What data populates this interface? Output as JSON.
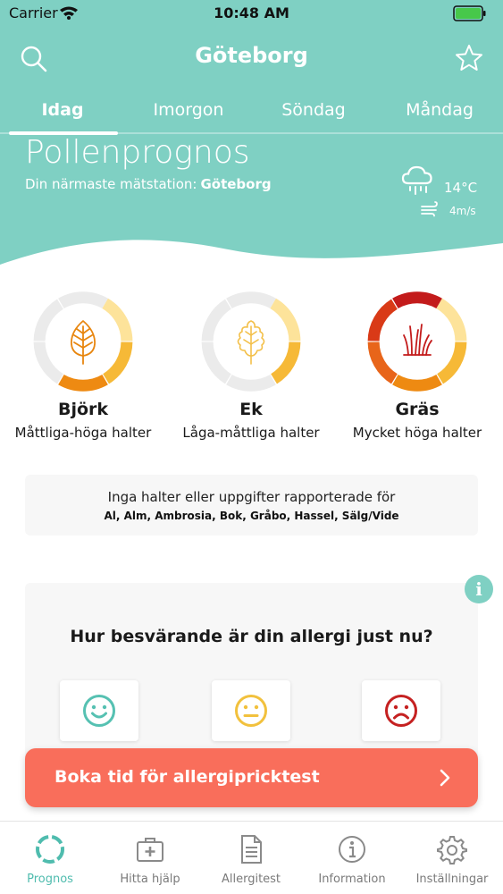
{
  "status_bar": {
    "carrier": "Carrier",
    "time": "10:48 AM"
  },
  "header": {
    "city": "Göteborg",
    "icons": [
      "search-icon",
      "star-icon"
    ]
  },
  "tabs": [
    {
      "label": "Idag",
      "active": true
    },
    {
      "label": "Imorgon",
      "active": false
    },
    {
      "label": "Söndag",
      "active": false
    },
    {
      "label": "Måndag",
      "active": false
    }
  ],
  "forecast": {
    "title": "Pollenprognos",
    "station_label": "Din närmaste mätstation:",
    "station_name": "Göteborg",
    "temperature": "14°C",
    "wind": "4m/s",
    "weather_icon": "cloud-rain-icon"
  },
  "pollen": [
    {
      "name": "Björk",
      "level": "Måttliga-höga halter",
      "icon": "birch-leaf-icon",
      "segments_filled": 3
    },
    {
      "name": "Ek",
      "level": "Låga-måttliga halter",
      "icon": "oak-leaf-icon",
      "segments_filled": 2
    },
    {
      "name": "Gräs",
      "level": "Mycket höga halter",
      "icon": "grass-icon",
      "segments_filled": 6
    }
  ],
  "no_data": {
    "text": "Inga halter eller uppgifter rapporterade för",
    "species": "Al, Alm, Ambrosia, Bok, Gråbo, Hassel, Sälg/Vide"
  },
  "allergy": {
    "question": "Hur besvärande är din allergi just nu?",
    "faces": [
      "happy-face-icon",
      "neutral-face-icon",
      "sad-face-icon"
    ]
  },
  "cta": {
    "label": "Boka tid för allergipricktest"
  },
  "colors": {
    "teal": "#7fd0c3",
    "cta": "#f96e5b",
    "low": "#fde39a",
    "mid": "#f6b937",
    "high": "#ee8a12",
    "very_high": "#c31b1b"
  },
  "tabbar": [
    {
      "label": "Prognos",
      "icon": "prognos-icon",
      "active": true
    },
    {
      "label": "Hitta hjälp",
      "icon": "medical-kit-icon",
      "active": false
    },
    {
      "label": "Allergitest",
      "icon": "document-icon",
      "active": false
    },
    {
      "label": "Information",
      "icon": "info-icon",
      "active": false
    },
    {
      "label": "Inställningar",
      "icon": "gear-icon",
      "active": false
    }
  ]
}
